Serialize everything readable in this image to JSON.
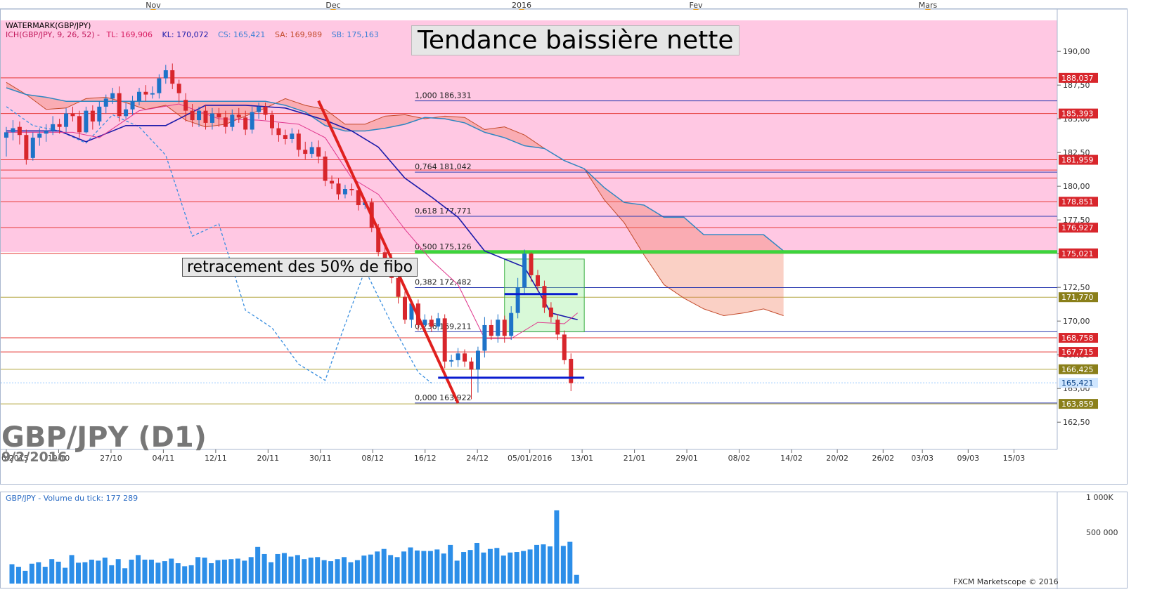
{
  "header": {
    "months": [
      "Nov",
      "Dec",
      "2016",
      "Fev",
      "Mars"
    ],
    "watermark": "WATERMARK(GBP/JPY)",
    "ichimoku_label": "ICH(GBP/JPY, 9, 26, 52) -",
    "tl": "TL: 169,906",
    "kl": "KL: 170,072",
    "cs": "CS: 165,421",
    "sa": "SA: 169,989",
    "sb": "SB: 175,163"
  },
  "annotations": {
    "title": "Tendance baissière nette",
    "retracement": "retracement des 50% de fibo",
    "symbol": "GBP/JPY (D1)",
    "date": "9/2/2016"
  },
  "volume": {
    "label": "GBP/JPY - Volume du tick: 177 289",
    "axis": [
      "1 000K",
      "500 000"
    ],
    "footer": "FXCM Marketscope © 2016"
  },
  "colors": {
    "bull": "#1e73c8",
    "bear": "#d8262c",
    "cloud_bg": "#ffc8e3",
    "fib_green": "#3cd43c"
  },
  "chart_data": {
    "type": "candlestick",
    "instrument": "GBP/JPY",
    "timeframe": "D1",
    "ylim": [
      161.0,
      192.3
    ],
    "y_ticks": [
      "190,00",
      "187,50",
      "185,00",
      "182,50",
      "180,00",
      "177,50",
      "175,00",
      "172,50",
      "170,00",
      "167,50",
      "165,00",
      "162,50"
    ],
    "x_ticks": [
      "07/10/2015",
      "19/10",
      "27/10",
      "04/11",
      "12/11",
      "20/11",
      "30/11",
      "08/12",
      "16/12",
      "24/12",
      "05/01/2016",
      "13/01",
      "21/01",
      "29/01",
      "08/02",
      "14/02",
      "20/02",
      "26/02",
      "03/03",
      "09/03",
      "15/03"
    ],
    "price_labels": [
      {
        "text": "188,037",
        "value": 188.037,
        "type": "red"
      },
      {
        "text": "185,393",
        "value": 185.393,
        "type": "red"
      },
      {
        "text": "181,959",
        "value": 181.959,
        "type": "red"
      },
      {
        "text": "178,851",
        "value": 178.851,
        "type": "red"
      },
      {
        "text": "176,927",
        "value": 176.927,
        "type": "red"
      },
      {
        "text": "175,021",
        "value": 175.021,
        "type": "red"
      },
      {
        "text": "171,770",
        "value": 171.77,
        "type": "olive"
      },
      {
        "text": "168,758",
        "value": 168.758,
        "type": "red"
      },
      {
        "text": "167,715",
        "value": 167.715,
        "type": "red"
      },
      {
        "text": "166,425",
        "value": 166.425,
        "type": "olive"
      },
      {
        "text": "165,421",
        "value": 165.421,
        "type": "current"
      },
      {
        "text": "163,859",
        "value": 163.859,
        "type": "olive"
      }
    ],
    "fib_levels": [
      {
        "label": "1,000 186,331",
        "value": 186.331
      },
      {
        "label": "0,764 181,042",
        "value": 181.042
      },
      {
        "label": "0,618 177,771",
        "value": 177.771
      },
      {
        "label": "0,500 175,126",
        "value": 175.126
      },
      {
        "label": "0,382 172,482",
        "value": 172.482
      },
      {
        "label": "0,236 169,211",
        "value": 169.211
      },
      {
        "label": "0,000 163,922",
        "value": 163.922
      }
    ],
    "candles": [
      [
        0,
        183.6,
        184.0,
        182.2,
        184.4
      ],
      [
        1,
        184.0,
        184.3,
        183.4,
        184.9
      ],
      [
        2,
        184.4,
        183.8,
        183.1,
        184.8
      ],
      [
        3,
        183.8,
        182.0,
        181.6,
        184.2
      ],
      [
        4,
        182.1,
        183.6,
        181.9,
        184.0
      ],
      [
        5,
        183.6,
        183.9,
        183.0,
        184.3
      ],
      [
        6,
        183.9,
        184.1,
        183.3,
        184.6
      ],
      [
        7,
        184.1,
        184.6,
        183.8,
        185.2
      ],
      [
        8,
        184.6,
        184.4,
        183.9,
        185.0
      ],
      [
        9,
        184.4,
        185.4,
        184.0,
        185.8
      ],
      [
        10,
        185.4,
        185.2,
        184.8,
        185.9
      ],
      [
        11,
        185.2,
        184.0,
        183.6,
        185.6
      ],
      [
        12,
        184.0,
        185.6,
        183.9,
        185.9
      ],
      [
        13,
        185.6,
        184.8,
        184.2,
        186.0
      ],
      [
        14,
        184.8,
        185.9,
        184.5,
        186.3
      ],
      [
        15,
        185.9,
        186.5,
        185.4,
        186.8
      ],
      [
        16,
        186.5,
        186.9,
        186.1,
        187.3
      ],
      [
        17,
        186.9,
        185.2,
        184.8,
        187.4
      ],
      [
        18,
        185.2,
        185.7,
        185.0,
        186.2
      ],
      [
        19,
        185.7,
        186.3,
        185.3,
        186.7
      ],
      [
        20,
        186.3,
        187.0,
        186.0,
        187.3
      ],
      [
        21,
        187.0,
        186.8,
        186.3,
        187.5
      ],
      [
        22,
        186.8,
        186.9,
        186.5,
        187.4
      ],
      [
        23,
        186.9,
        188.0,
        186.5,
        188.3
      ],
      [
        24,
        188.0,
        188.6,
        187.6,
        189.0
      ],
      [
        25,
        188.6,
        187.6,
        187.2,
        189.1
      ],
      [
        26,
        187.6,
        186.9,
        186.2,
        187.9
      ],
      [
        27,
        186.4,
        185.6,
        184.8,
        186.9
      ],
      [
        28,
        185.6,
        184.9,
        184.4,
        186.1
      ],
      [
        29,
        184.9,
        185.6,
        184.4,
        185.9
      ],
      [
        30,
        185.6,
        184.7,
        184.2,
        186.0
      ],
      [
        31,
        184.7,
        185.4,
        184.2,
        185.8
      ],
      [
        32,
        185.4,
        185.1,
        184.4,
        185.8
      ],
      [
        33,
        185.1,
        184.4,
        183.9,
        185.6
      ],
      [
        34,
        184.4,
        185.3,
        184.1,
        185.7
      ],
      [
        35,
        185.3,
        185.1,
        184.7,
        185.8
      ],
      [
        36,
        185.1,
        184.2,
        183.8,
        185.6
      ],
      [
        37,
        184.2,
        185.5,
        183.9,
        185.9
      ],
      [
        38,
        185.5,
        185.9,
        185.0,
        186.2
      ],
      [
        39,
        185.9,
        185.3,
        184.9,
        186.2
      ],
      [
        40,
        185.3,
        184.3,
        183.8,
        185.6
      ],
      [
        41,
        184.3,
        183.8,
        183.3,
        184.7
      ],
      [
        42,
        183.8,
        183.5,
        183.1,
        184.2
      ],
      [
        43,
        183.5,
        183.9,
        183.2,
        184.3
      ],
      [
        44,
        183.9,
        182.7,
        182.2,
        184.2
      ],
      [
        45,
        182.7,
        182.4,
        182.0,
        183.3
      ],
      [
        46,
        182.4,
        182.9,
        182.1,
        183.3
      ],
      [
        47,
        182.9,
        182.2,
        181.7,
        183.4
      ],
      [
        48,
        182.2,
        180.4,
        180.0,
        182.6
      ],
      [
        49,
        180.4,
        180.2,
        179.8,
        180.8
      ],
      [
        50,
        180.2,
        179.4,
        179.0,
        180.6
      ],
      [
        51,
        179.4,
        179.8,
        179.1,
        180.1
      ],
      [
        52,
        179.8,
        179.7,
        179.3,
        180.2
      ],
      [
        53,
        179.7,
        178.6,
        178.2,
        180.0
      ],
      [
        54,
        178.6,
        178.8,
        178.3,
        179.0
      ],
      [
        55,
        178.8,
        176.9,
        176.6,
        179.1
      ],
      [
        56,
        176.9,
        175.1,
        174.8,
        177.2
      ],
      [
        57,
        175.1,
        174.6,
        174.2,
        175.5
      ],
      [
        58,
        174.6,
        173.2,
        172.8,
        175.0
      ],
      [
        59,
        173.2,
        171.8,
        171.3,
        173.6
      ],
      [
        60,
        171.8,
        170.1,
        169.8,
        172.2
      ],
      [
        61,
        170.1,
        171.3,
        169.5,
        171.6
      ],
      [
        62,
        171.3,
        169.7,
        169.3,
        171.6
      ],
      [
        63,
        169.7,
        170.1,
        169.4,
        170.5
      ],
      [
        64,
        170.1,
        169.6,
        169.2,
        170.4
      ],
      [
        65,
        169.6,
        170.2,
        169.3,
        170.6
      ],
      [
        66,
        170.2,
        167.0,
        166.5,
        170.5
      ],
      [
        67,
        167.0,
        167.1,
        166.6,
        167.5
      ],
      [
        68,
        167.1,
        167.6,
        166.6,
        168.0
      ],
      [
        69,
        167.6,
        167.0,
        166.6,
        167.9
      ],
      [
        70,
        167.0,
        166.4,
        164.2,
        167.3
      ],
      [
        71,
        166.4,
        167.8,
        164.7,
        168.1
      ],
      [
        72,
        167.8,
        169.7,
        167.3,
        170.3
      ],
      [
        73,
        169.7,
        168.9,
        168.6,
        170.1
      ],
      [
        74,
        168.9,
        170.1,
        168.4,
        170.5
      ],
      [
        75,
        170.1,
        168.9,
        168.4,
        170.4
      ],
      [
        76,
        168.9,
        170.6,
        168.6,
        171.1
      ],
      [
        77,
        170.6,
        172.5,
        170.2,
        173.2
      ],
      [
        78,
        172.5,
        175.0,
        172.0,
        175.3
      ],
      [
        79,
        175.0,
        173.4,
        172.9,
        175.1
      ],
      [
        80,
        173.4,
        172.6,
        172.2,
        173.8
      ],
      [
        81,
        172.6,
        171.0,
        170.6,
        173.0
      ],
      [
        82,
        171.0,
        170.3,
        169.9,
        171.4
      ],
      [
        83,
        170.1,
        169.0,
        168.6,
        170.5
      ],
      [
        84,
        169.0,
        167.1,
        166.8,
        169.3
      ],
      [
        85,
        167.2,
        165.4,
        164.8,
        167.6
      ]
    ],
    "kumo_span_a": [
      [
        0,
        187.7
      ],
      [
        3,
        186.8
      ],
      [
        6,
        185.7
      ],
      [
        9,
        185.8
      ],
      [
        12,
        186.5
      ],
      [
        15,
        186.6
      ],
      [
        18,
        186.2
      ],
      [
        21,
        185.7
      ],
      [
        24,
        186.0
      ],
      [
        27,
        184.9
      ],
      [
        30,
        184.4
      ],
      [
        33,
        184.6
      ],
      [
        36,
        185.2
      ],
      [
        39,
        185.8
      ],
      [
        42,
        186.5
      ],
      [
        45,
        186.0
      ],
      [
        48,
        185.7
      ],
      [
        51,
        184.6
      ],
      [
        54,
        184.6
      ],
      [
        57,
        185.2
      ],
      [
        60,
        185.3
      ],
      [
        63,
        185.0
      ],
      [
        66,
        185.2
      ],
      [
        69,
        185.1
      ],
      [
        72,
        184.2
      ],
      [
        75,
        184.4
      ],
      [
        78,
        183.8
      ],
      [
        81,
        182.8
      ],
      [
        84,
        181.9
      ],
      [
        87,
        181.3
      ],
      [
        90,
        179.0
      ],
      [
        93,
        177.3
      ],
      [
        96,
        174.9
      ],
      [
        99,
        172.7
      ],
      [
        102,
        171.7
      ],
      [
        105,
        170.9
      ],
      [
        108,
        170.4
      ],
      [
        111,
        170.6
      ],
      [
        114,
        170.9
      ],
      [
        117,
        170.4
      ]
    ],
    "kumo_span_b": [
      [
        0,
        187.3
      ],
      [
        3,
        186.8
      ],
      [
        6,
        186.6
      ],
      [
        9,
        186.3
      ],
      [
        12,
        186.3
      ],
      [
        15,
        186.3
      ],
      [
        18,
        186.3
      ],
      [
        21,
        186.3
      ],
      [
        24,
        186.3
      ],
      [
        27,
        186.3
      ],
      [
        30,
        186.3
      ],
      [
        33,
        186.3
      ],
      [
        36,
        186.3
      ],
      [
        39,
        186.3
      ],
      [
        42,
        186.0
      ],
      [
        45,
        185.5
      ],
      [
        48,
        184.5
      ],
      [
        51,
        184.1
      ],
      [
        54,
        184.1
      ],
      [
        57,
        184.3
      ],
      [
        60,
        184.6
      ],
      [
        63,
        185.1
      ],
      [
        66,
        185.0
      ],
      [
        69,
        184.7
      ],
      [
        72,
        184.0
      ],
      [
        75,
        183.6
      ],
      [
        78,
        183.0
      ],
      [
        81,
        182.8
      ],
      [
        84,
        181.9
      ],
      [
        87,
        181.3
      ],
      [
        90,
        179.9
      ],
      [
        93,
        178.8
      ],
      [
        96,
        178.6
      ],
      [
        99,
        177.7
      ],
      [
        102,
        177.7
      ],
      [
        105,
        176.4
      ],
      [
        108,
        176.4
      ],
      [
        111,
        176.4
      ],
      [
        114,
        176.4
      ],
      [
        117,
        175.2
      ]
    ],
    "kijun": [
      [
        0,
        184.1
      ],
      [
        8,
        184.1
      ],
      [
        12,
        183.3
      ],
      [
        18,
        184.5
      ],
      [
        24,
        184.5
      ],
      [
        30,
        186.0
      ],
      [
        36,
        186.0
      ],
      [
        42,
        185.8
      ],
      [
        48,
        184.9
      ],
      [
        52,
        184.1
      ],
      [
        56,
        182.9
      ],
      [
        60,
        180.6
      ],
      [
        64,
        179.2
      ],
      [
        68,
        177.7
      ],
      [
        72,
        175.2
      ],
      [
        78,
        174.0
      ],
      [
        82,
        170.6
      ],
      [
        86,
        170.1
      ]
    ],
    "tenkan": [
      [
        0,
        184.0
      ],
      [
        10,
        184.0
      ],
      [
        14,
        183.6
      ],
      [
        20,
        185.6
      ],
      [
        26,
        186.1
      ],
      [
        32,
        185.0
      ],
      [
        38,
        184.9
      ],
      [
        44,
        184.6
      ],
      [
        48,
        183.6
      ],
      [
        52,
        180.6
      ],
      [
        56,
        179.4
      ],
      [
        60,
        176.8
      ],
      [
        64,
        174.5
      ],
      [
        68,
        172.7
      ],
      [
        72,
        168.7
      ],
      [
        76,
        168.7
      ],
      [
        80,
        169.9
      ],
      [
        84,
        169.8
      ],
      [
        86,
        170.6
      ]
    ],
    "chikou": [
      [
        0,
        185.9
      ],
      [
        4,
        184.5
      ],
      [
        8,
        184.1
      ],
      [
        12,
        183.2
      ],
      [
        16,
        185.3
      ],
      [
        20,
        184.4
      ],
      [
        24,
        182.3
      ],
      [
        28,
        176.3
      ],
      [
        32,
        177.2
      ],
      [
        36,
        170.8
      ],
      [
        40,
        169.5
      ],
      [
        44,
        166.8
      ],
      [
        48,
        165.6
      ],
      [
        50,
        168.4
      ],
      [
        54,
        173.8
      ],
      [
        58,
        169.8
      ],
      [
        62,
        166.2
      ],
      [
        64,
        165.4
      ]
    ],
    "trend_line": {
      "from": [
        47,
        186.331
      ],
      "to": [
        68,
        163.922
      ]
    },
    "support_line": {
      "from": [
        65,
        165.8
      ],
      "to": [
        87,
        165.8
      ]
    },
    "resistance_line": {
      "from": [
        75,
        172.0
      ],
      "to": [
        86,
        172.0
      ]
    },
    "consolidation_box": {
      "x": [
        75,
        87
      ],
      "y": [
        169.2,
        174.6
      ]
    },
    "volumes": [
      380,
      330,
      250,
      390,
      420,
      330,
      480,
      430,
      310,
      560,
      410,
      420,
      470,
      450,
      510,
      360,
      480,
      300,
      470,
      560,
      470,
      470,
      410,
      440,
      490,
      400,
      340,
      360,
      520,
      510,
      400,
      460,
      470,
      480,
      490,
      450,
      520,
      720,
      580,
      420,
      580,
      600,
      530,
      560,
      480,
      510,
      520,
      460,
      440,
      480,
      520,
      420,
      460,
      550,
      570,
      630,
      680,
      560,
      520,
      630,
      710,
      650,
      640,
      640,
      670,
      590,
      760,
      450,
      620,
      660,
      800,
      610,
      680,
      700,
      550,
      610,
      620,
      640,
      670,
      760,
      770,
      730,
      1440,
      740,
      820,
      170
    ]
  }
}
